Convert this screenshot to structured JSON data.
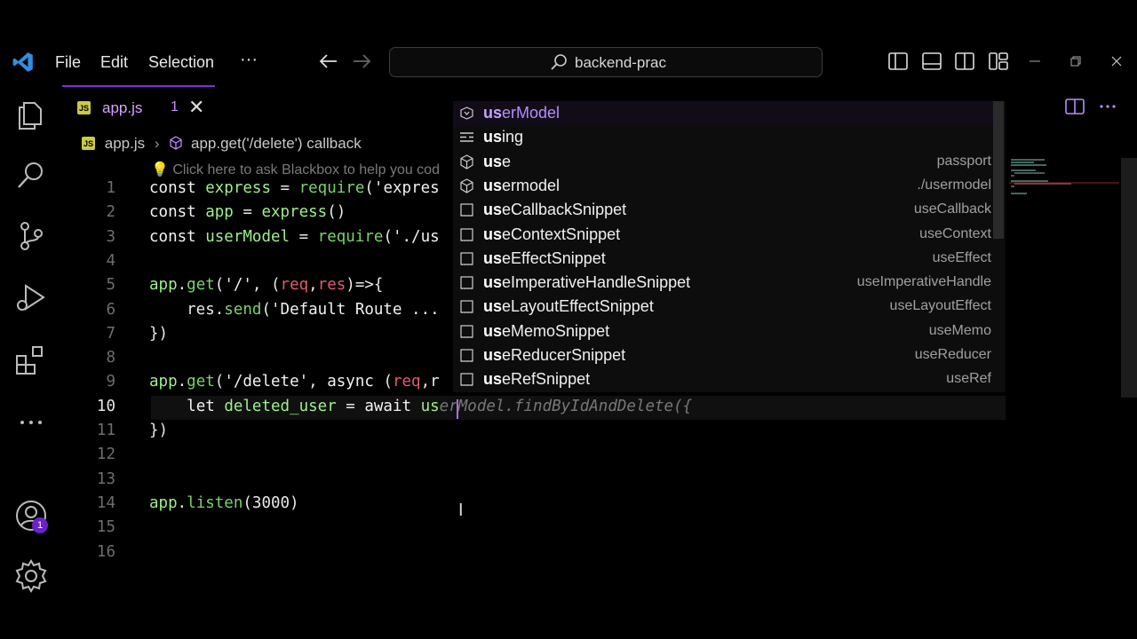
{
  "menu": {
    "file": "File",
    "edit": "Edit",
    "selection": "Selection",
    "more": "···"
  },
  "search": {
    "text": "backend-prac"
  },
  "tab": {
    "label": "app.js",
    "problems": "1",
    "badge": "JS"
  },
  "breadcrumb": {
    "file": "app.js",
    "symbol": "app.get('/delete') callback"
  },
  "hint": {
    "text": "Click here to ask Blackbox to help you cod"
  },
  "accent": "#7b2fd6",
  "activity": {
    "badge_count": "1"
  },
  "editor": {
    "lines": [
      {
        "num": "1",
        "code": "const express = require('expres"
      },
      {
        "num": "2",
        "code": "const app = express()"
      },
      {
        "num": "3",
        "code": "const userModel = require('./us"
      },
      {
        "num": "4",
        "code": ""
      },
      {
        "num": "5",
        "code": "app.get('/', (req,res)=>{"
      },
      {
        "num": "6",
        "code": "    res.send('Default Route ..."
      },
      {
        "num": "7",
        "code": "})"
      },
      {
        "num": "8",
        "code": ""
      },
      {
        "num": "9",
        "code": "app.get('/delete', async (req,r"
      },
      {
        "num": "10",
        "code": "    let deleted_user = await us"
      },
      {
        "num": "11",
        "code": "})"
      },
      {
        "num": "12",
        "code": ""
      },
      {
        "num": "13",
        "code": ""
      },
      {
        "num": "14",
        "code": "app.listen(3000)"
      },
      {
        "num": "15",
        "code": ""
      },
      {
        "num": "16",
        "code": ""
      }
    ],
    "ghost_text": "erModel.findByIdAndDelete({",
    "active_line": "10"
  },
  "suggestions": [
    {
      "match": "us",
      "rest": "erModel",
      "detail": "",
      "icon": "variable-icon",
      "selected": true
    },
    {
      "match": "us",
      "rest": "ing",
      "detail": "",
      "icon": "keyword-icon"
    },
    {
      "match": "us",
      "rest": "e",
      "detail": "passport",
      "icon": "module-icon"
    },
    {
      "match": "us",
      "rest": "ermodel",
      "detail": "./usermodel",
      "icon": "module-icon"
    },
    {
      "match": "us",
      "rest": "eCallbackSnippet",
      "detail": "useCallback",
      "icon": "snippet-icon"
    },
    {
      "match": "us",
      "rest": "eContextSnippet",
      "detail": "useContext",
      "icon": "snippet-icon"
    },
    {
      "match": "us",
      "rest": "eEffectSnippet",
      "detail": "useEffect",
      "icon": "snippet-icon"
    },
    {
      "match": "us",
      "rest": "eImperativeHandleSnippet",
      "detail": "useImperativeHandle",
      "icon": "snippet-icon"
    },
    {
      "match": "us",
      "rest": "eLayoutEffectSnippet",
      "detail": "useLayoutEffect",
      "icon": "snippet-icon"
    },
    {
      "match": "us",
      "rest": "eMemoSnippet",
      "detail": "useMemo",
      "icon": "snippet-icon"
    },
    {
      "match": "us",
      "rest": "eReducerSnippet",
      "detail": "useReducer",
      "icon": "snippet-icon"
    },
    {
      "match": "us",
      "rest": "eRefSnippet",
      "detail": "useRef",
      "icon": "snippet-icon"
    }
  ]
}
